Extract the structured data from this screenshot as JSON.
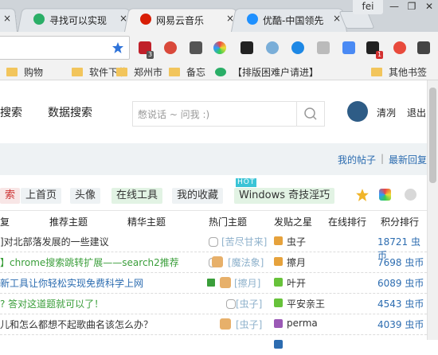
{
  "browser": {
    "user": "fei",
    "tabs": [
      {
        "title": "寻找可以实现",
        "close": "×",
        "color": "#2aae67"
      },
      {
        "title": "网易云音乐",
        "close": "×",
        "color": "#d81e06"
      },
      {
        "title": "优酷-中国领先",
        "close": "×",
        "color": "#1e90ff"
      }
    ],
    "ext_badges": {
      "ud": "3",
      "red": "1"
    },
    "bookmarks": [
      {
        "label": "购物"
      },
      {
        "label": "软件下载"
      },
      {
        "label": "郑州市"
      },
      {
        "label": "备忘"
      },
      {
        "label": "【排版困难户请进】"
      },
      {
        "label": "其他书签"
      }
    ],
    "window_controls": {
      "min": "—",
      "max": "❐",
      "close": "✕"
    }
  },
  "header": {
    "left_cut": "搜索",
    "data_search": "数据搜索",
    "search_placeholder": "憋说话 ~ 问我 :)",
    "username": "清冽",
    "logout": "退出"
  },
  "subbar": {
    "my_posts": "我的帖子",
    "newest_reply": "最新回复",
    "separator": "|"
  },
  "nav": {
    "items": [
      "索",
      "上首页",
      "头像",
      "在线工具",
      "我的收藏",
      "Windows 奇技淫巧"
    ],
    "hot_badge": "HOT"
  },
  "columns": [
    "复",
    "推荐主题",
    "精华主题",
    "热门主题",
    "发贴之星",
    "在线排行",
    "积分排行"
  ],
  "rows": [
    {
      "title": "]对北部落发展的一些建议",
      "color": "#333333",
      "tag": "[苦尽甘来]",
      "poster": "虫子",
      "icon_color": "#e6a23c",
      "points": "18721 虫币"
    },
    {
      "title": "】chrome搜索跳转扩展——search2推荐",
      "color": "#3a9e3a",
      "tag": "[魔法象]",
      "poster": "擦月",
      "icon_color": "#e6a23c",
      "points": "7698 虫币"
    },
    {
      "title": "新工具让你轻松实现免费科学上网",
      "color": "#2c6cb0",
      "tag": "[擦月]",
      "poster": "叶开",
      "icon_color": "#67c23a",
      "points": "6089 虫币"
    },
    {
      "title": "? 答对这道题就可以了！",
      "color": "#3a9e3a",
      "tag": "[虫子]",
      "poster": "平安亲王",
      "icon_color": "#67c23a",
      "points": "4543 虫币"
    },
    {
      "title": "儿和怎么都想不起歌曲名该怎么办？",
      "color": "#333333",
      "tag": "[虫子]",
      "poster": "perma",
      "icon_color": "#9b59b6",
      "points": "4039 虫币"
    },
    {
      "title": "",
      "color": "#d9534f",
      "tag": "",
      "poster": "",
      "icon_color": "#2c6cb0",
      "points": ""
    }
  ]
}
